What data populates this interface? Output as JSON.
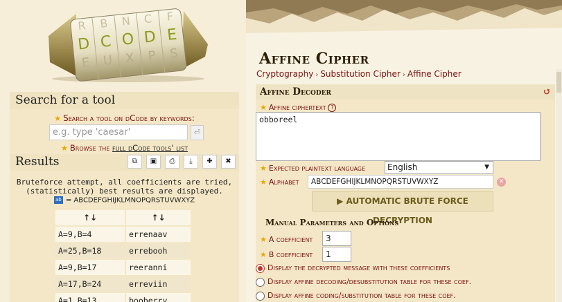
{
  "logo": {
    "letters": [
      "D",
      "C",
      "O",
      "D",
      "E"
    ]
  },
  "search": {
    "title": "Search for a tool",
    "label": "Search a tool on dCode by keywords:",
    "placeholder": "e.g. type 'caesar'",
    "go_symbol": "⏎",
    "browse_prefix": "Browse the",
    "browse_link": "full dCode tools' list"
  },
  "results": {
    "title": "Results",
    "tools": [
      "copy-icon",
      "save-icon",
      "print-icon",
      "download-icon",
      "pin-icon",
      "close-icon"
    ],
    "note_line1": "Bruteforce attempt, all coefficients are tried,",
    "note_line2": "(statistically) best results are displayed.",
    "alphabet_prefix": "=",
    "alphabet": "ABCDEFGHIJKLMNOPQRSTUVWXYZ",
    "columns": [
      "↑↓",
      "↑↓"
    ],
    "rows": [
      {
        "coef": "A=9,B=4",
        "text": "errenaav"
      },
      {
        "coef": "A=25,B=18",
        "text": "errebooh"
      },
      {
        "coef": "A=9,B=17",
        "text": "reeranni"
      },
      {
        "coef": "A=17,B=24",
        "text": "erreviin"
      },
      {
        "coef": "A=1,B=13",
        "text": "booberry"
      }
    ]
  },
  "page": {
    "title": "Affine Cipher",
    "breadcrumb": [
      "Cryptography",
      "Substitution Cipher",
      "Affine Cipher"
    ]
  },
  "decoder": {
    "title": "Affine Decoder",
    "reset_symbol": "↺",
    "ciphertext_label": "Affine ciphertext",
    "ciphertext_value": "obboreel",
    "language_label": "Expected plaintext language",
    "language_value": "English",
    "alphabet_label": "Alphabet",
    "alphabet_value": "ABCDEFGHIJKLMNOPQRSTUVWXYZ",
    "brute_button": "▶ AUTOMATIC BRUTE FORCE DECRYPTION",
    "manual_title": "Manual Parameters and Options",
    "a_label": "A coefficient",
    "a_value": "3",
    "b_label": "B coefficient",
    "b_value": "1",
    "options": [
      {
        "label": "Display the decrypted message with these coefficients",
        "selected": true
      },
      {
        "label": "Display affine decoding/desubstitution table for these coef.",
        "selected": false
      },
      {
        "label": "Display affine coding/substitution table for these coef.",
        "selected": false
      }
    ]
  },
  "colors": {
    "accent": "#7a1010",
    "panel": "#f4e7c7",
    "radio_selected": "#c0392b"
  }
}
